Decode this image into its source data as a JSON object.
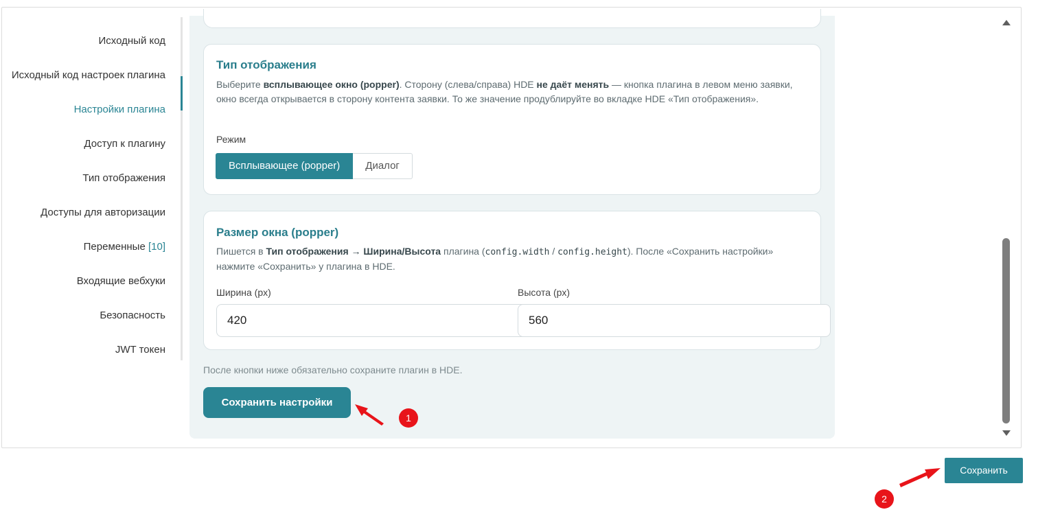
{
  "sidebar": {
    "items": [
      {
        "label": "Исходный код"
      },
      {
        "label": "Исходный код настроек плагина"
      },
      {
        "label": "Настройки плагина"
      },
      {
        "label": "Доступ к плагину"
      },
      {
        "label": "Тип отображения"
      },
      {
        "label": "Доступы для авторизации"
      },
      {
        "label": "Переменные",
        "count": "[10]"
      },
      {
        "label": "Входящие вебхуки"
      },
      {
        "label": "Безопасность"
      },
      {
        "label": "JWT токен"
      }
    ],
    "active_index": 2
  },
  "display_type_card": {
    "title": "Тип отображения",
    "desc_1": "Выберите ",
    "desc_bold_1": "всплывающее окно (popper)",
    "desc_2": ". Сторону (слева/справа) HDE ",
    "desc_bold_2": "не даёт менять",
    "desc_3": " — кнопка плагина в левом меню заявки, окно всегда открывается в сторону контента заявки. То же значение продублируйте во вкладке HDE «Тип отображения».",
    "mode_label": "Режим",
    "mode_options": [
      "Всплывающее (popper)",
      "Диалог"
    ],
    "mode_selected": "Всплывающее (popper)"
  },
  "size_card": {
    "title": "Размер окна (popper)",
    "desc_1": "Пишется в ",
    "desc_bold": "Тип отображения → Ширина/Высота",
    "desc_2": " плагина (",
    "code_1": "config.width",
    "desc_3": " / ",
    "code_2": "config.height",
    "desc_4": "). После «Сохранить настройки» нажмите «Сохранить» у плагина в HDE.",
    "width_label": "Ширина (px)",
    "width_value": "420",
    "height_label": "Высота (px)",
    "height_value": "560"
  },
  "hint": "После кнопки ниже обязательно сохраните плагин в HDE.",
  "save_settings_label": "Сохранить настройки",
  "save_label": "Сохранить",
  "annotations": {
    "badge_1": "1",
    "badge_2": "2",
    "color": "#e8141a"
  },
  "colors": {
    "accent": "#2a8594",
    "panel_bg": "#eef4f5"
  }
}
